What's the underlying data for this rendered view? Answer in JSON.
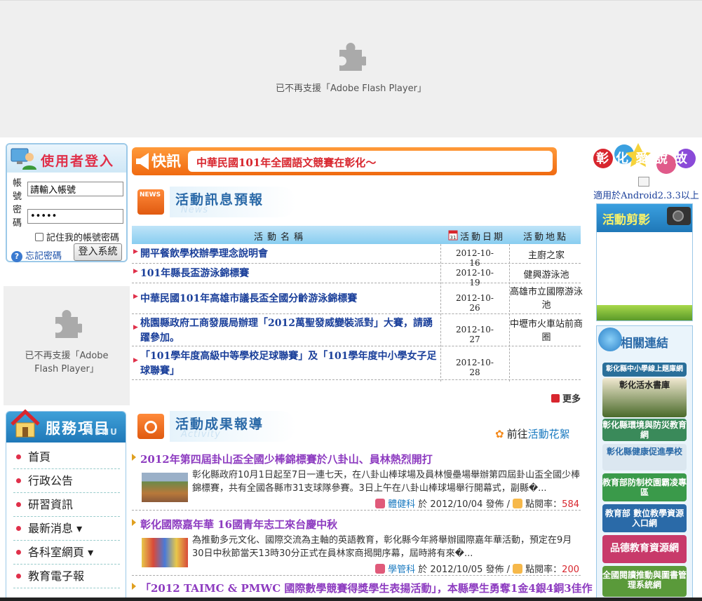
{
  "flash": {
    "top_message": "已不再支援「Adobe Flash Player」",
    "left_message_line1": "已不再支援「Adobe",
    "left_message_line2": "Flash Player」"
  },
  "login": {
    "title": "使用者登入",
    "account_label": "帳號",
    "password_label": "密碼",
    "account_value": "請輸入帳號",
    "password_value": "•••••",
    "remember_label": "記住我的帳號密碼",
    "forgot_label": "忘記密碼",
    "submit_label": "登入系統"
  },
  "service": {
    "title": "服務項目",
    "subtitle": "MENU",
    "items": [
      {
        "label": "首頁"
      },
      {
        "label": "行政公告"
      },
      {
        "label": "研習資訊"
      },
      {
        "label": "最新消息 ▾"
      },
      {
        "label": "各科室網頁 ▾"
      },
      {
        "label": "教育電子報"
      }
    ]
  },
  "kuaixun": {
    "tag": "快訊",
    "headline": "中華民國101年全國語文競賽在彰化～"
  },
  "news": {
    "title": "活動訊息預報",
    "subtitle": "News",
    "header_name": "活動名稱",
    "header_date": "活動日期",
    "header_place": "活動地點",
    "rows": [
      {
        "title": "開平餐飲學校辦學理念說明會",
        "date": "2012-10-16",
        "place": "主廚之家"
      },
      {
        "title": "101年縣長盃游泳錦標賽",
        "date": "2012-10-19",
        "place": "健興游泳池"
      },
      {
        "title": "中華民國101年高雄市議長盃全國分齡游泳錦標賽",
        "date": "2012-10-26",
        "place": "高雄市立國際游泳池"
      },
      {
        "title": "桃園縣政府工商發展局辦理「2012萬聖發威變裝派對」大賽，請踴躍參加。",
        "date": "2012-10-27",
        "place": "中壢市火車站前商圈"
      },
      {
        "title": "「101學年度高級中等學校足球聯賽」及「101學年度中小學女子足球聯賽」",
        "date": "2012-10-28",
        "place": ""
      }
    ],
    "more_label": "更多"
  },
  "activity": {
    "title": "活動成果報導",
    "subtitle": "Activity",
    "goto_prefix": "前往",
    "goto_link": "活動花絮",
    "items": [
      {
        "title": "2012年第四屆卦山盃全國少棒錦標賽於八卦山、員林熱烈開打",
        "desc": "彰化縣政府10月1日起至7日一連七天，在八卦山棒球場及員林慢壘場舉辦第四屆卦山盃全國少棒錦標賽，共有全國各縣市31支球隊參賽。3日上午在八卦山棒球場舉行開幕式，副縣�...",
        "author": "體健科",
        "on": "於",
        "date": "2012/10/04",
        "published": "發佈 /",
        "hits_label": "點閱率：",
        "hits": "584"
      },
      {
        "title": "彰化國際嘉年華 16國青年志工來台慶中秋",
        "desc": "為推動多元文化、國際交流為主軸的英語教育，彰化縣今年將舉辦國際嘉年華活動，預定在9月30日中秋節當天13時30分正式在員林家商揭開序幕，屆時將有來�...",
        "author": "學管科",
        "on": "於",
        "date": "2012/10/05",
        "published": "發佈 /",
        "hits_label": "點閱率：",
        "hits": "200"
      },
      {
        "title": "「2012 TAIMC & PMWC 國際數學競賽得獎學生表揚活動」，本縣學生勇奪1金4銀4銅3佳作"
      }
    ]
  },
  "right": {
    "logo_text": "彰化愛說故",
    "android_label": "適用於Android2.3.3以上",
    "photo_title": "活動剪影",
    "links_title": "相關連結",
    "links": [
      {
        "label": "彰化縣中小學線上題庫網",
        "color": "#2a6f9a"
      },
      {
        "label": "彰化活水書庫",
        "color": "#4a6a2a"
      },
      {
        "label": "彰化縣環境與防災教育網",
        "color": "#3a8a5a"
      },
      {
        "label": "彰化縣健康促進學校",
        "color": "#6a8aa8"
      },
      {
        "label": "教育部防制校園霸凌專區",
        "color": "#3a9a4a"
      },
      {
        "label": "教育部 數位教學資源入口網",
        "color": "#2a6aa8"
      },
      {
        "label": "品德教育資源網",
        "color": "#c83a6a"
      },
      {
        "label": "全國閱讀推動與圖書管理系統網",
        "color": "#5a9a3a"
      }
    ]
  }
}
